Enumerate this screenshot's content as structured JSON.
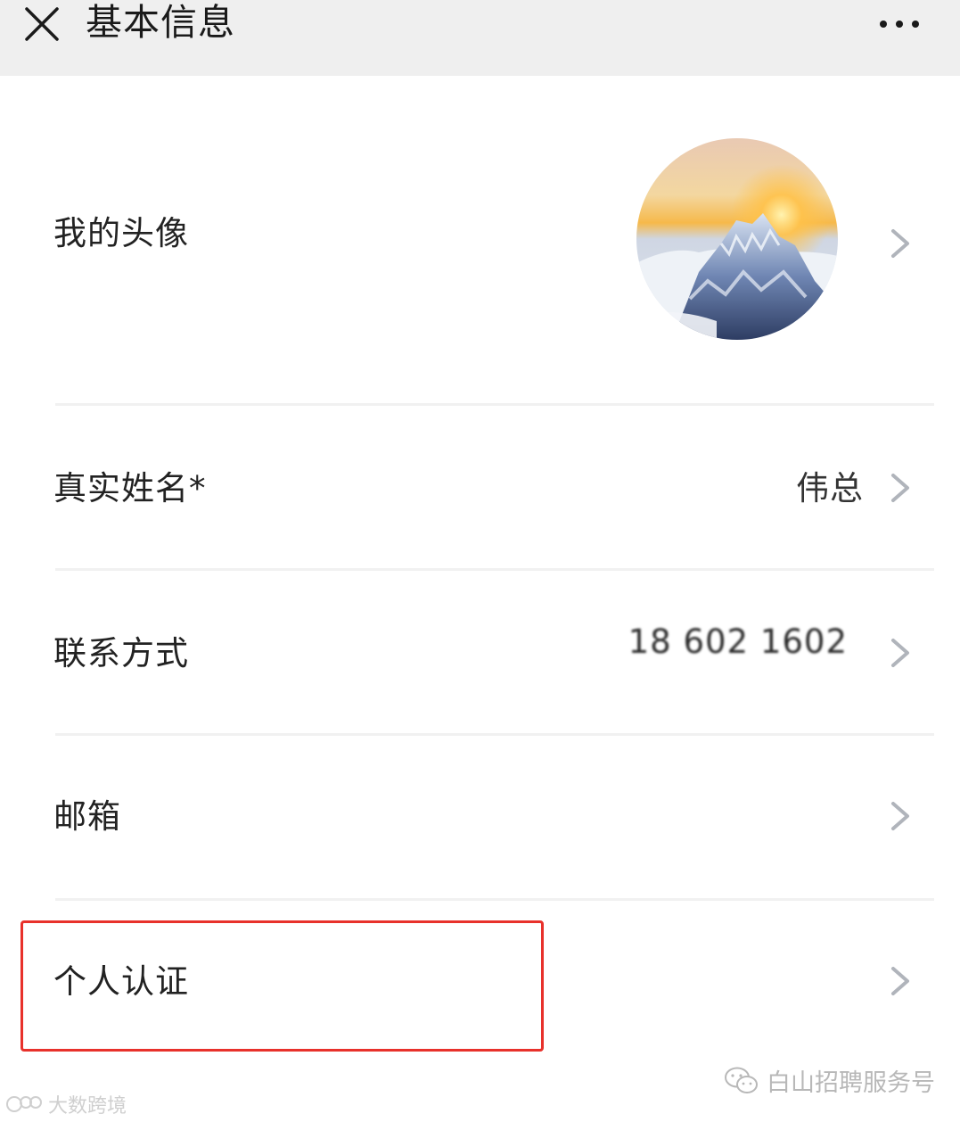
{
  "header": {
    "title": "基本信息",
    "close_icon": "close-icon",
    "more_icon": "more-icon"
  },
  "rows": {
    "avatar": {
      "label": "我的头像",
      "icon": "chevron-right-icon"
    },
    "name": {
      "label": "真实姓名*",
      "value": "伟总",
      "icon": "chevron-right-icon"
    },
    "phone": {
      "label": "联系方式",
      "value": "18 602 1602",
      "icon": "chevron-right-icon"
    },
    "email": {
      "label": "邮箱",
      "icon": "chevron-right-icon"
    },
    "cert": {
      "label": "个人认证",
      "icon": "chevron-right-icon"
    }
  },
  "watermarks": {
    "wechat": "白山招聘服务号",
    "source": "大数跨境"
  },
  "colors": {
    "header_bg": "#efefef",
    "highlight": "#e8312b",
    "chevron": "#b0b4bb"
  }
}
